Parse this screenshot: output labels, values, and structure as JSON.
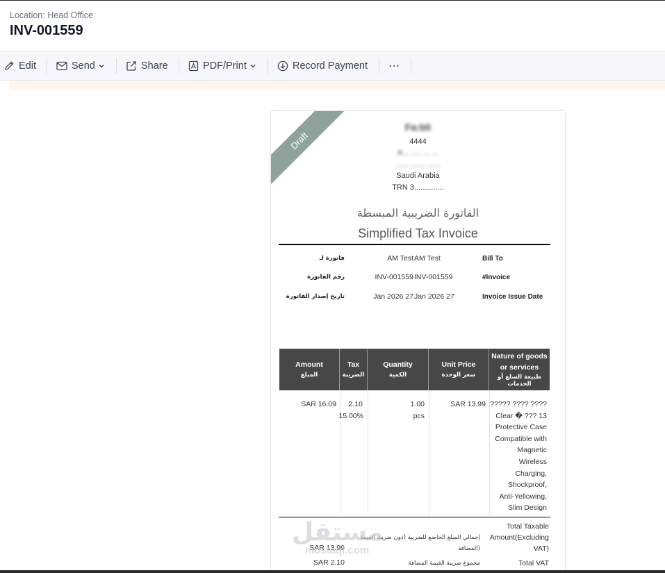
{
  "header": {
    "location": "Location: Head Office",
    "title": "INV-001559"
  },
  "toolbar": {
    "edit": "Edit",
    "send": "Send",
    "share": "Share",
    "pdf_print": "PDF/Print",
    "record_payment": "Record Payment",
    "more": "⋯"
  },
  "invoice": {
    "ribbon": "Draft",
    "company": {
      "name": "Fa:bli",
      "line1": "4444",
      "line2": "A... ..... ... ...",
      "line3": "...... ....... ......",
      "country": "Saudi Arabia",
      "trn": "TRN 3.............."
    },
    "title_ar": "الفاتورة الضريبية المبسطة",
    "title_en": "Simplified Tax Invoice",
    "meta": [
      {
        "ar": "فاتورة لـ",
        "v1": "AM Test",
        "v2": "AM Test",
        "en": "Bill To"
      },
      {
        "ar": "رقم الفاتورة",
        "v1": "INV-001559",
        "v2": "INV-001559",
        "en": "#Invoice"
      },
      {
        "ar": "تاريخ إصدار الفاتورة",
        "v1": "Jan 2026 27",
        "v2": "Jan 2026 27",
        "en": "Invoice Issue Date"
      }
    ],
    "table": {
      "headers": [
        {
          "en": "Amount",
          "ar": "المبلغ"
        },
        {
          "en": "Tax",
          "ar": "الضريبة"
        },
        {
          "en": "Quantity",
          "ar": "الكمية"
        },
        {
          "en": "Unit Price",
          "ar": "سعر الوحدة"
        },
        {
          "en": "Nature of goods",
          "en2": "or services",
          "ar": "طبيعة السلع أو الخدمات"
        }
      ],
      "row": {
        "amount": "SAR 16.09",
        "tax_amount": "2.10",
        "tax_rate": "15.00%",
        "quantity": "1.00",
        "unit": "pcs",
        "unit_price": "SAR 13.99",
        "description": [
          "????? ???? ????",
          "Clear � ??? 13",
          "Protective Case",
          "Compatible with",
          "Magnetic",
          "Wireless",
          "Charging,",
          "Shockproof,",
          "Anti-Yellowing,",
          "Slim Design"
        ]
      }
    },
    "totals": {
      "taxable_en": [
        "Total Taxable",
        "Amount(Excluding",
        "VAT)"
      ],
      "taxable_ar": [
        "إجمالي المبلغ الخاضع للضريبة (دون ضريبة القيمة",
        "المضافة)"
      ],
      "taxable_value": "SAR 13.99",
      "vat_en": "Total VAT",
      "vat_ar": "مجموع ضريبة القيمة المضافة",
      "vat_value": "SAR 2.10"
    }
  },
  "watermark": {
    "ar": "مستقل",
    "en": "mostaql.com"
  }
}
